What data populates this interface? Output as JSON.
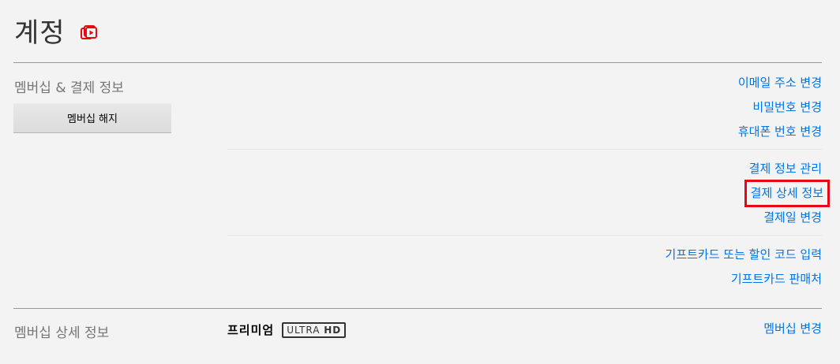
{
  "header": {
    "title": "계정",
    "member_icon": "member-since-icon",
    "accent_color": "#e50914"
  },
  "membership_billing": {
    "heading": "멤버십 & 결제 정보",
    "cancel_button": "멤버십 해지",
    "account_links": [
      "이메일 주소 변경",
      "비밀번호 변경",
      "휴대폰 번호 변경"
    ],
    "billing_links": [
      "결제 정보 관리",
      "결제 상세 정보",
      "결제일 변경"
    ],
    "gift_links": [
      "기프트카드 또는 할인 코드 입력",
      "기프트카드 판매처"
    ]
  },
  "plan_details": {
    "heading": "멤버십 상세 정보",
    "plan_name": "프리미엄",
    "badge_ultra": "ULTRA",
    "badge_hd": "HD",
    "change_link": "멤버십 변경"
  },
  "link_color": "#0073e6"
}
